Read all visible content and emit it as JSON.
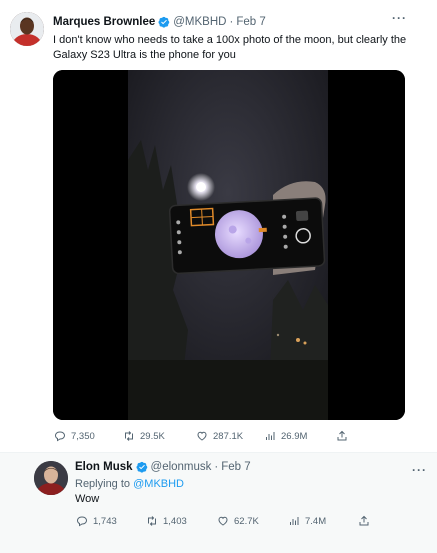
{
  "tweet1": {
    "name": "Marques Brownlee",
    "handle": "@MKBHD",
    "separator": "·",
    "date": "Feb 7",
    "more": "···",
    "text_line1": "I don't know who needs to take a 100x photo of the moon, but clearly the",
    "text_line2": "Galaxy S23 Ultra is the phone for you",
    "stats": {
      "replies": "7,350",
      "retweets": "29.5K",
      "likes": "287.1K",
      "views": "26.9M"
    }
  },
  "tweet2": {
    "name": "Elon Musk",
    "handle": "@elonmusk",
    "separator": "·",
    "date": "Feb 7",
    "more": "···",
    "replying_prefix": "Replying to",
    "replying_to": "@MKBHD",
    "text": "Wow",
    "stats": {
      "replies": "1,743",
      "retweets": "1,403",
      "likes": "62.7K",
      "views": "7.4M"
    }
  },
  "colors": {
    "verified": "#1d9bf0",
    "muted": "#536471",
    "link": "#1d9bf0"
  }
}
